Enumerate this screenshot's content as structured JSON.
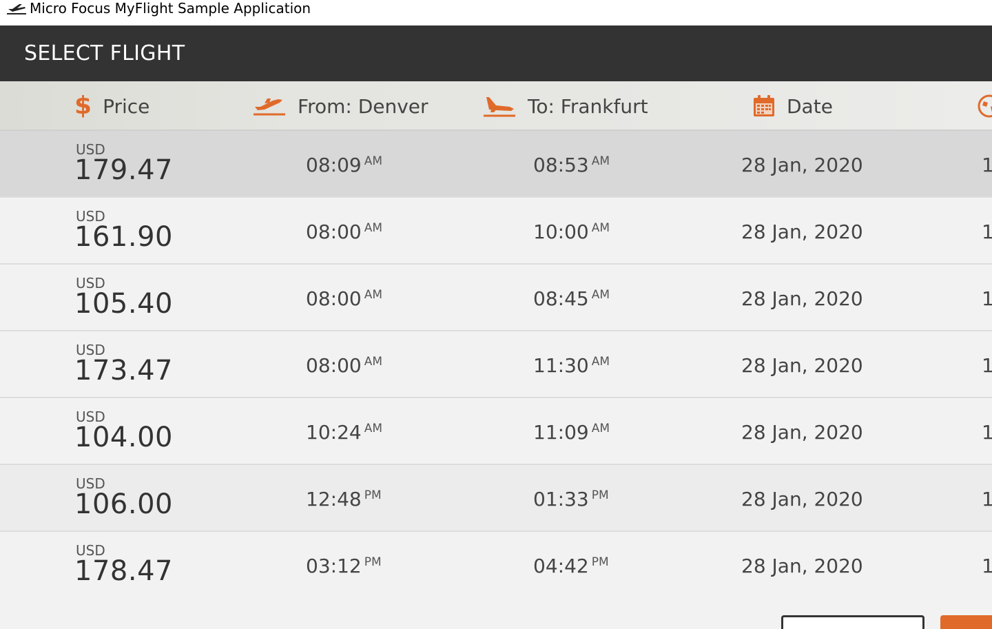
{
  "window": {
    "title": "Micro Focus MyFlight Sample Application",
    "icon": "airplane-icon"
  },
  "header": {
    "title": "SELECT FLIGHT"
  },
  "columns": {
    "price": {
      "label": "Price",
      "icon": "dollar-icon"
    },
    "from": {
      "label": "From: Denver",
      "icon": "takeoff-icon"
    },
    "to": {
      "label": "To: Frankfurt",
      "icon": "landing-icon"
    },
    "date": {
      "label": "Date",
      "icon": "calendar-icon"
    },
    "extra": {
      "icon": "globe-icon"
    }
  },
  "flights": [
    {
      "currency": "USD",
      "price": "179.47",
      "dep_time": "08:09",
      "dep_ampm": "AM",
      "arr_time": "08:53",
      "arr_ampm": "AM",
      "date": "28 Jan, 2020",
      "extra": "1"
    },
    {
      "currency": "USD",
      "price": "161.90",
      "dep_time": "08:00",
      "dep_ampm": "AM",
      "arr_time": "10:00",
      "arr_ampm": "AM",
      "date": "28 Jan, 2020",
      "extra": "1"
    },
    {
      "currency": "USD",
      "price": "105.40",
      "dep_time": "08:00",
      "dep_ampm": "AM",
      "arr_time": "08:45",
      "arr_ampm": "AM",
      "date": "28 Jan, 2020",
      "extra": "1"
    },
    {
      "currency": "USD",
      "price": "173.47",
      "dep_time": "08:00",
      "dep_ampm": "AM",
      "arr_time": "11:30",
      "arr_ampm": "AM",
      "date": "28 Jan, 2020",
      "extra": "1"
    },
    {
      "currency": "USD",
      "price": "104.00",
      "dep_time": "10:24",
      "dep_ampm": "AM",
      "arr_time": "11:09",
      "arr_ampm": "AM",
      "date": "28 Jan, 2020",
      "extra": "1"
    },
    {
      "currency": "USD",
      "price": "106.00",
      "dep_time": "12:48",
      "dep_ampm": "PM",
      "arr_time": "01:33",
      "arr_ampm": "PM",
      "date": "28 Jan, 2020",
      "extra": "1"
    },
    {
      "currency": "USD",
      "price": "178.47",
      "dep_time": "03:12",
      "dep_ampm": "PM",
      "arr_time": "04:42",
      "arr_ampm": "PM",
      "date": "28 Jan, 2020",
      "extra": "1"
    }
  ],
  "colors": {
    "accent": "#e06a2a",
    "header_bg": "#333333",
    "selected_row": "#d8d8d8"
  }
}
